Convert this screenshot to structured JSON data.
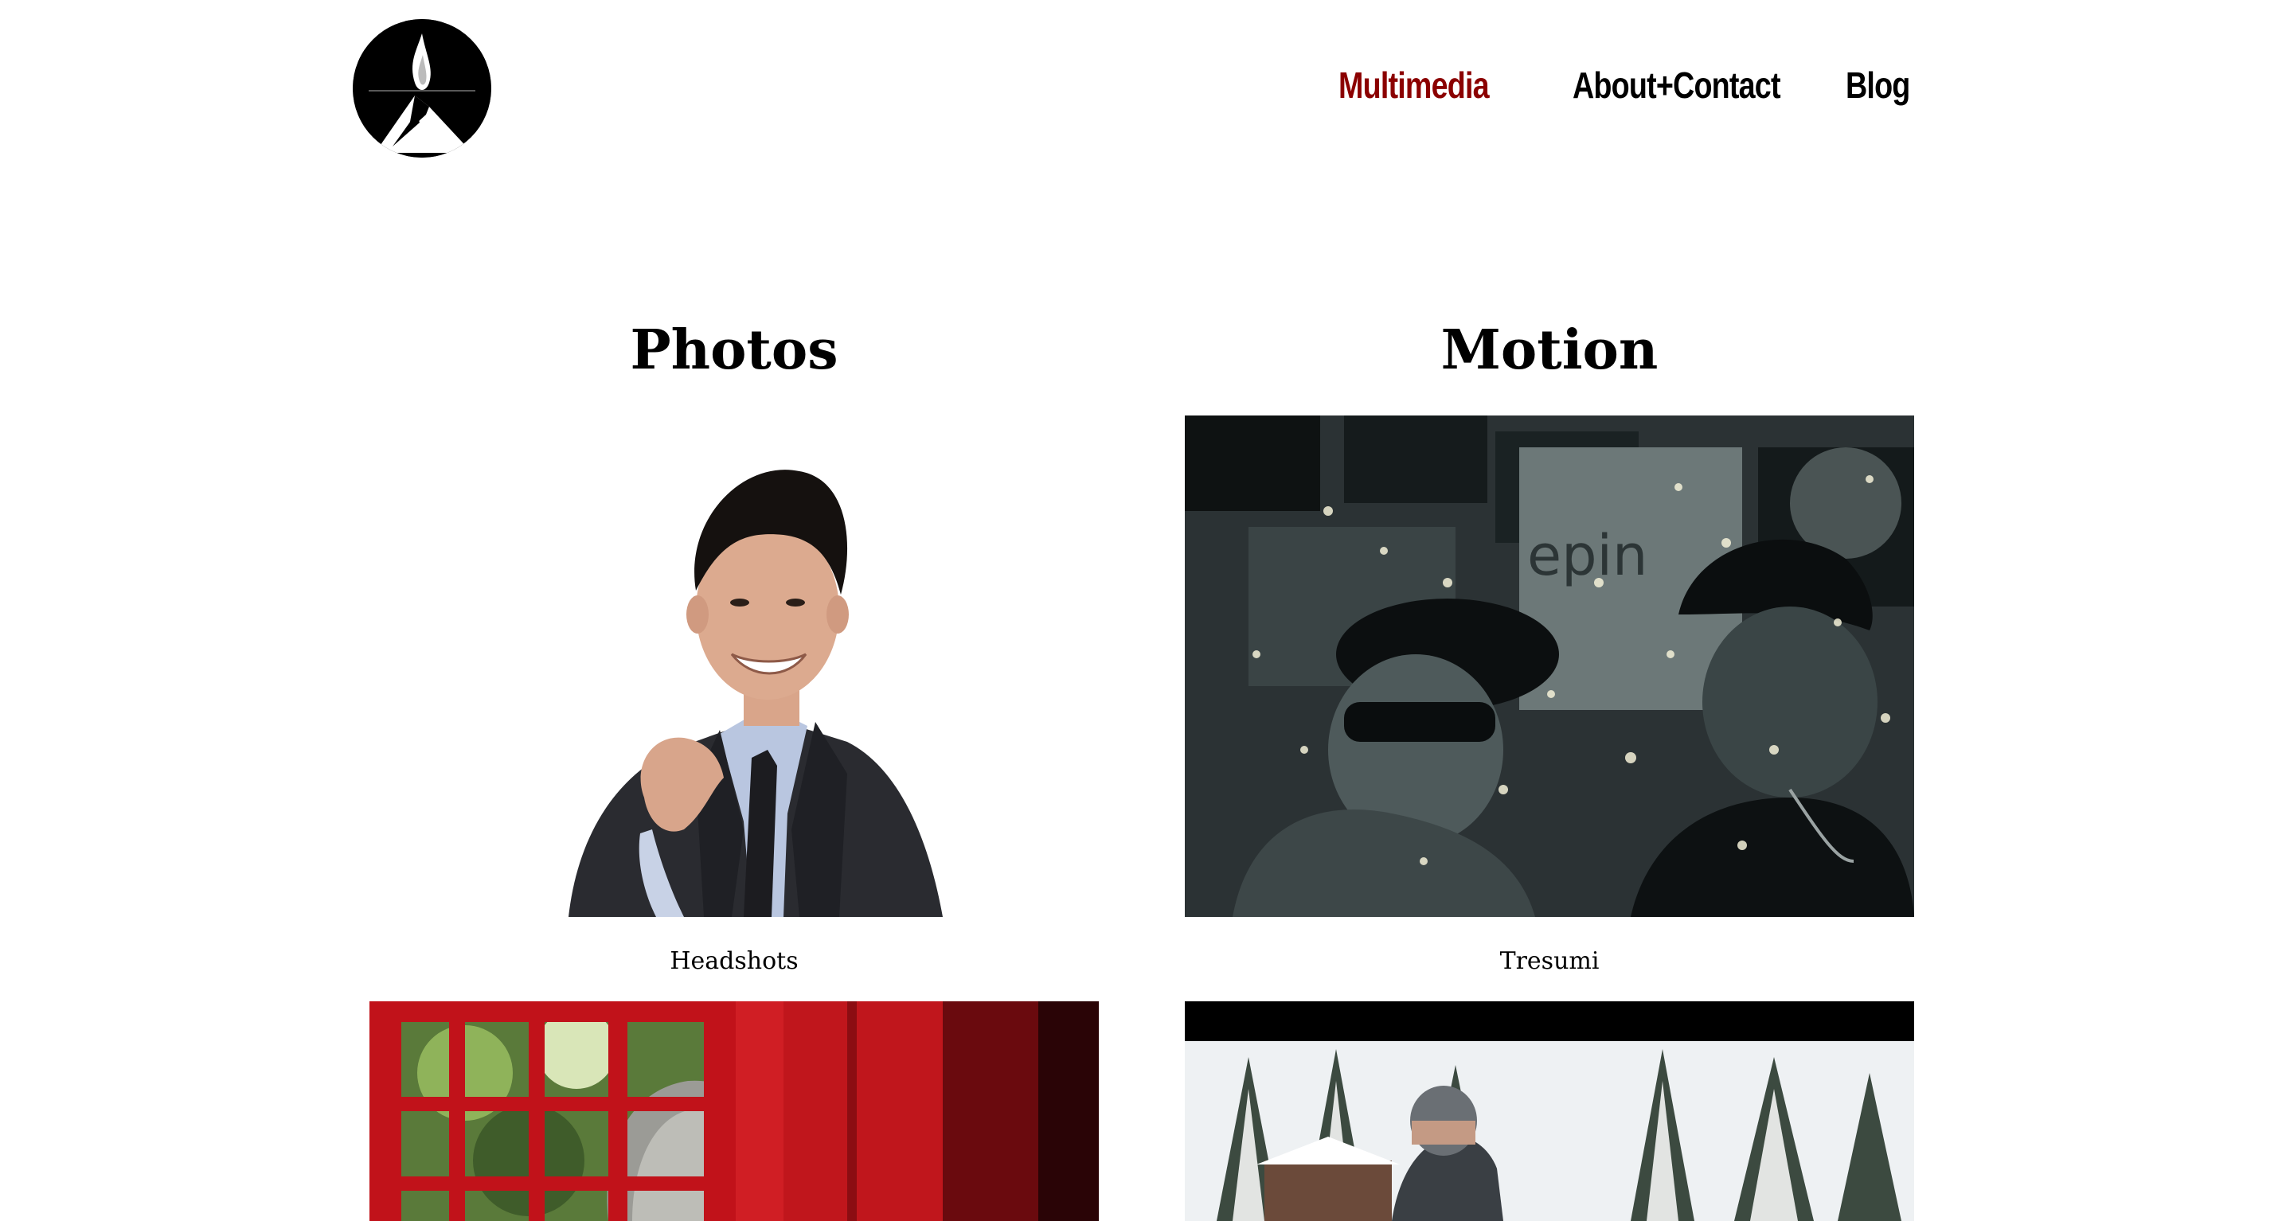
{
  "nav": {
    "items": [
      {
        "label": "Multimedia",
        "active": true
      },
      {
        "label": "About+Contact",
        "active": false
      },
      {
        "label": "Blog",
        "active": false
      }
    ],
    "active_color": "#8b0000"
  },
  "sections": {
    "photos": {
      "heading": "Photos",
      "tiles": [
        {
          "caption": "Headshots"
        },
        {
          "caption": ""
        }
      ]
    },
    "motion": {
      "heading": "Motion",
      "tiles": [
        {
          "caption": "Tresumi"
        },
        {
          "caption": ""
        }
      ]
    }
  }
}
